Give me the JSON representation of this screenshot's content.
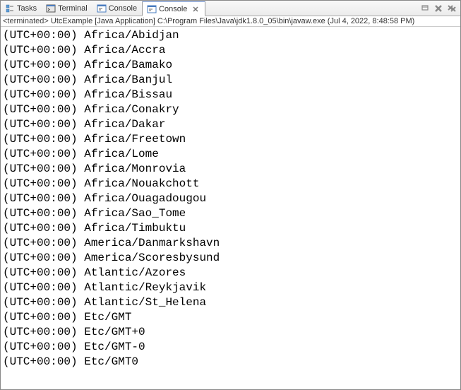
{
  "tabs": [
    {
      "label": "Tasks",
      "icon": "tasks"
    },
    {
      "label": "Terminal",
      "icon": "terminal"
    },
    {
      "label": "Console",
      "icon": "console"
    },
    {
      "label": "Console",
      "icon": "console",
      "active": true,
      "closable": true
    }
  ],
  "status": {
    "terminated": "<terminated>",
    "text": " UtcExample [Java Application] C:\\Program Files\\Java\\jdk1.8.0_05\\bin\\javaw.exe (Jul 4, 2022, 8:48:58 PM)"
  },
  "console_lines": [
    "(UTC+00:00) Africa/Abidjan",
    "(UTC+00:00) Africa/Accra",
    "(UTC+00:00) Africa/Bamako",
    "(UTC+00:00) Africa/Banjul",
    "(UTC+00:00) Africa/Bissau",
    "(UTC+00:00) Africa/Conakry",
    "(UTC+00:00) Africa/Dakar",
    "(UTC+00:00) Africa/Freetown",
    "(UTC+00:00) Africa/Lome",
    "(UTC+00:00) Africa/Monrovia",
    "(UTC+00:00) Africa/Nouakchott",
    "(UTC+00:00) Africa/Ouagadougou",
    "(UTC+00:00) Africa/Sao_Tome",
    "(UTC+00:00) Africa/Timbuktu",
    "(UTC+00:00) America/Danmarkshavn",
    "(UTC+00:00) America/Scoresbysund",
    "(UTC+00:00) Atlantic/Azores",
    "(UTC+00:00) Atlantic/Reykjavik",
    "(UTC+00:00) Atlantic/St_Helena",
    "(UTC+00:00) Etc/GMT",
    "(UTC+00:00) Etc/GMT+0",
    "(UTC+00:00) Etc/GMT-0",
    "(UTC+00:00) Etc/GMT0"
  ]
}
